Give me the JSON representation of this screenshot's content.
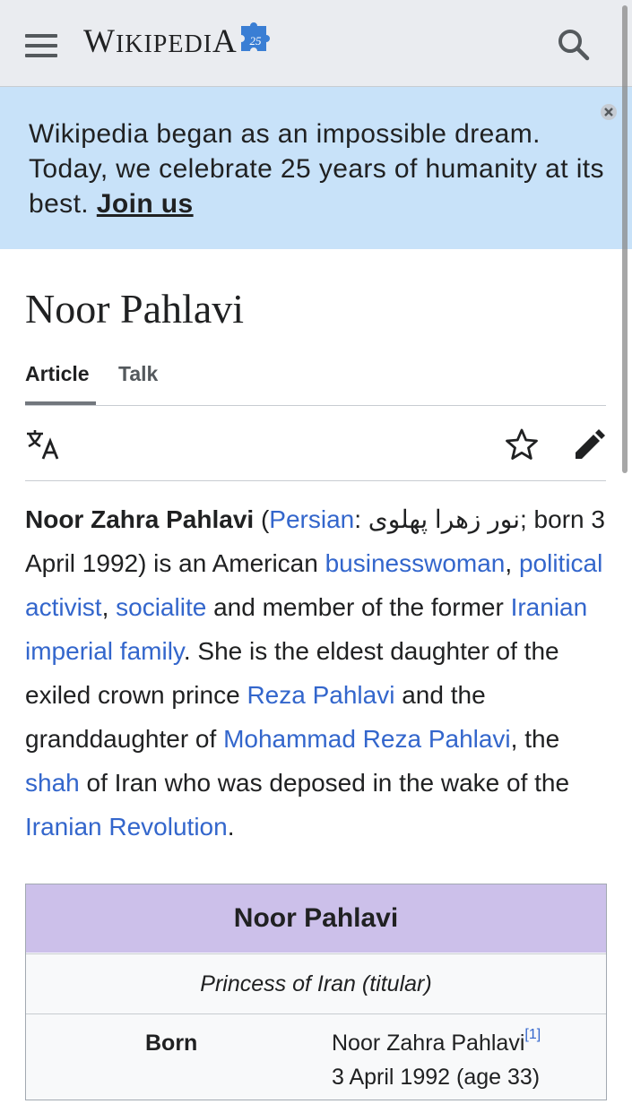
{
  "header": {
    "logo_first": "W",
    "logo_rest": "IKIPEDI",
    "logo_last": "A",
    "logo_badge": "25"
  },
  "banner": {
    "text": "Wikipedia began as an impossible dream. Today, we celebrate 25 years of humanity at its best.",
    "link": "Join us"
  },
  "page": {
    "title": "Noor Pahlavi",
    "tabs": [
      {
        "label": "Article",
        "active": true
      },
      {
        "label": "Talk",
        "active": false
      }
    ]
  },
  "intro": {
    "name_bold": "Noor Zahra Pahlavi",
    "open_paren": " (",
    "persian_link": "Persian",
    "persian_text": ": نور زهرا پهلوی",
    "t1": "; born 3 April 1992) is an American ",
    "link_businesswoman": "businesswoman",
    "t2": ", ",
    "link_political_activist": "political activist",
    "t3": ", ",
    "link_socialite": "socialite",
    "t4": " and member of the former ",
    "link_imperial_family": "Iranian imperial family",
    "t5": ". She is the eldest daughter of the exiled crown prince ",
    "link_reza": "Reza Pahlavi",
    "t6": " and the granddaughter of ",
    "link_mohammad": "Mohammad Reza Pahlavi",
    "t7": ", the ",
    "link_shah": "shah",
    "t8": " of Iran who was deposed in the wake of the ",
    "link_revolution": "Iranian Revolution",
    "t9": "."
  },
  "infobox": {
    "title": "Noor Pahlavi",
    "subtitle": "Princess of Iran (titular)",
    "born_label": "Born",
    "born_name": "Noor Zahra Pahlavi",
    "born_ref": "[1]",
    "born_date": "3 April 1992 (age 33)"
  },
  "colors": {
    "link": "#3366cc",
    "banner_bg": "#c8e2f9",
    "infobox_title_bg": "#ccc0ea",
    "header_bg": "#eaecf0"
  }
}
